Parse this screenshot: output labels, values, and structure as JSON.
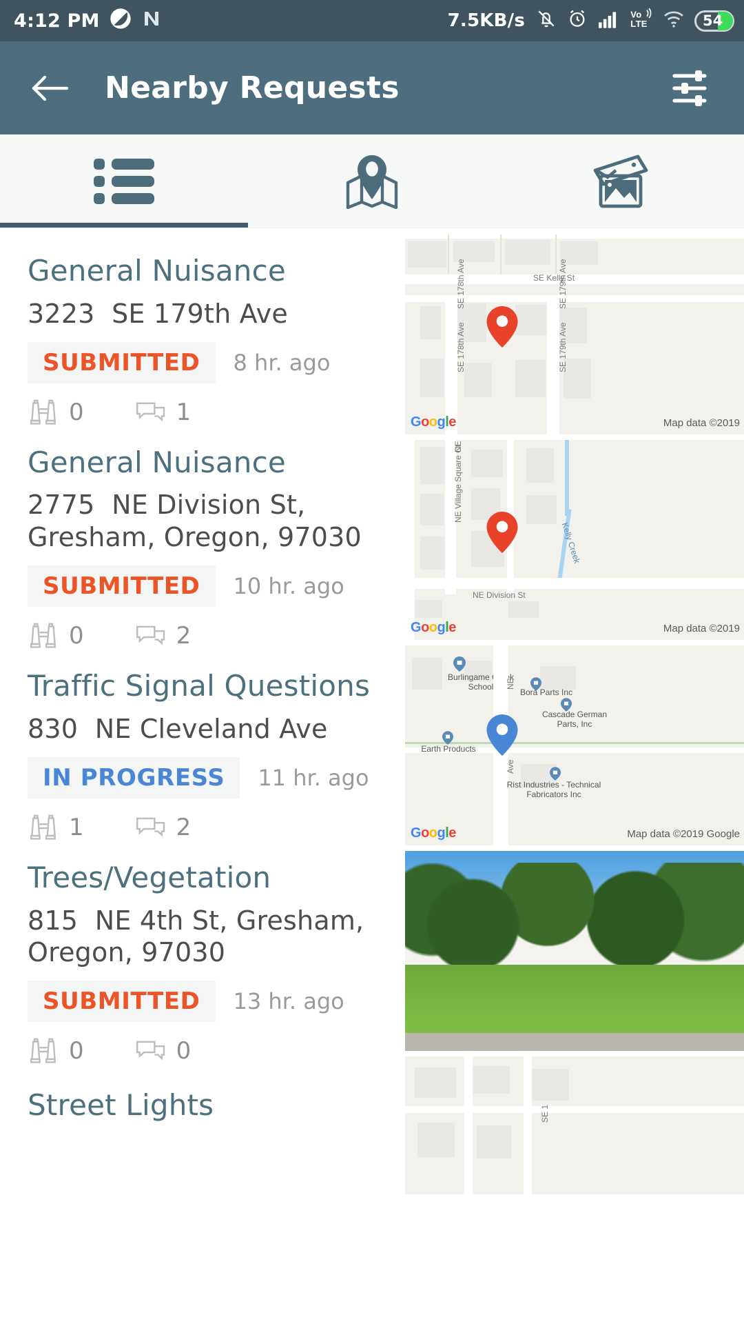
{
  "status_bar": {
    "time": "4:12 PM",
    "network_speed": "7.5KB/s",
    "battery_level": "54",
    "icons": [
      "app-badge-icon",
      "nova-launcher-icon",
      "notifications-muted-icon",
      "alarm-icon",
      "signal-bars-icon",
      "volte-icon",
      "wifi-icon",
      "battery-icon"
    ],
    "volte_label_top": "Vo",
    "volte_label_bottom": "LTE"
  },
  "app_bar": {
    "title": "Nearby Requests",
    "back_icon": "arrow-left-icon",
    "filter_icon": "filter-sliders-icon"
  },
  "tabs": {
    "items": [
      {
        "name": "list",
        "icon": "list-view-icon",
        "selected": true
      },
      {
        "name": "map",
        "icon": "map-pin-icon",
        "selected": false
      },
      {
        "name": "photos",
        "icon": "photo-gallery-icon",
        "selected": false
      }
    ]
  },
  "colors": {
    "appbar": "#4e6d7e",
    "statusbar": "#3f545e",
    "title_text": "#4d707f",
    "submitted": "#ec5428",
    "in_progress": "#4a86d6",
    "muted": "#9a9a9a",
    "battery_green": "#3ddc5b"
  },
  "requests": [
    {
      "title": "General Nuisance",
      "address_number": "3223",
      "address_street": "SE 179th Ave",
      "status": "SUBMITTED",
      "status_kind": "submitted",
      "time_ago": "8 hr. ago",
      "watch_count": "0",
      "comment_count": "1",
      "thumb_kind": "map",
      "map_labels": [
        "SE Kelly St",
        "SE 178th Ave",
        "SE 179th Ave",
        "SE 178th Ave",
        "SE 179th Ave"
      ],
      "map_attribution": "Map data ©2019",
      "pin_color": "#e8422a"
    },
    {
      "title": "General Nuisance",
      "address_number": "2775",
      "address_street": "NE Division St, Gresham, Oregon, 97030",
      "status": "SUBMITTED",
      "status_kind": "submitted",
      "time_ago": "10 hr. ago",
      "watch_count": "0",
      "comment_count": "2",
      "thumb_kind": "map",
      "map_labels": [
        "NE Village Square Ct",
        "NE Village Square Ct",
        "Kelly Creek",
        "NE Division St"
      ],
      "map_attribution": "Map data ©2019",
      "pin_color": "#e8422a"
    },
    {
      "title": "Traffic Signal Questions",
      "address_number": "830",
      "address_street": "NE Cleveland Ave",
      "status": "IN PROGRESS",
      "status_kind": "inprogress",
      "time_ago": "11 hr. ago",
      "watch_count": "1",
      "comment_count": "2",
      "thumb_kind": "map",
      "map_labels": [
        "Burlingame Creek School",
        "Bora Parts Inc",
        "Cascade German Parts, Inc",
        "Earth Products",
        "Rist Industries - Technical Fabricators Inc",
        "NE",
        "Ave"
      ],
      "map_attribution": "Map data ©2019 Google",
      "pin_color": "#4a86d6"
    },
    {
      "title": "Trees/Vegetation",
      "address_number": "815",
      "address_street": "NE 4th St, Gresham, Oregon, 97030",
      "status": "SUBMITTED",
      "status_kind": "submitted",
      "time_ago": "13 hr. ago",
      "watch_count": "0",
      "comment_count": "0",
      "thumb_kind": "photo",
      "map_labels": [],
      "map_attribution": "",
      "pin_color": ""
    },
    {
      "title": "Street Lights",
      "address_number": "",
      "address_street": "",
      "status": "",
      "status_kind": "",
      "time_ago": "",
      "watch_count": "",
      "comment_count": "",
      "thumb_kind": "map",
      "map_labels": [
        "SE 1"
      ],
      "map_attribution": "",
      "pin_color": "#e8422a"
    }
  ],
  "google_logo": {
    "g1": "G",
    "o1": "o",
    "o2": "o",
    "g2": "g",
    "l": "l",
    "e": "e"
  },
  "icon_names": {
    "watch": "binoculars-icon",
    "comments": "speech-bubbles-icon"
  }
}
